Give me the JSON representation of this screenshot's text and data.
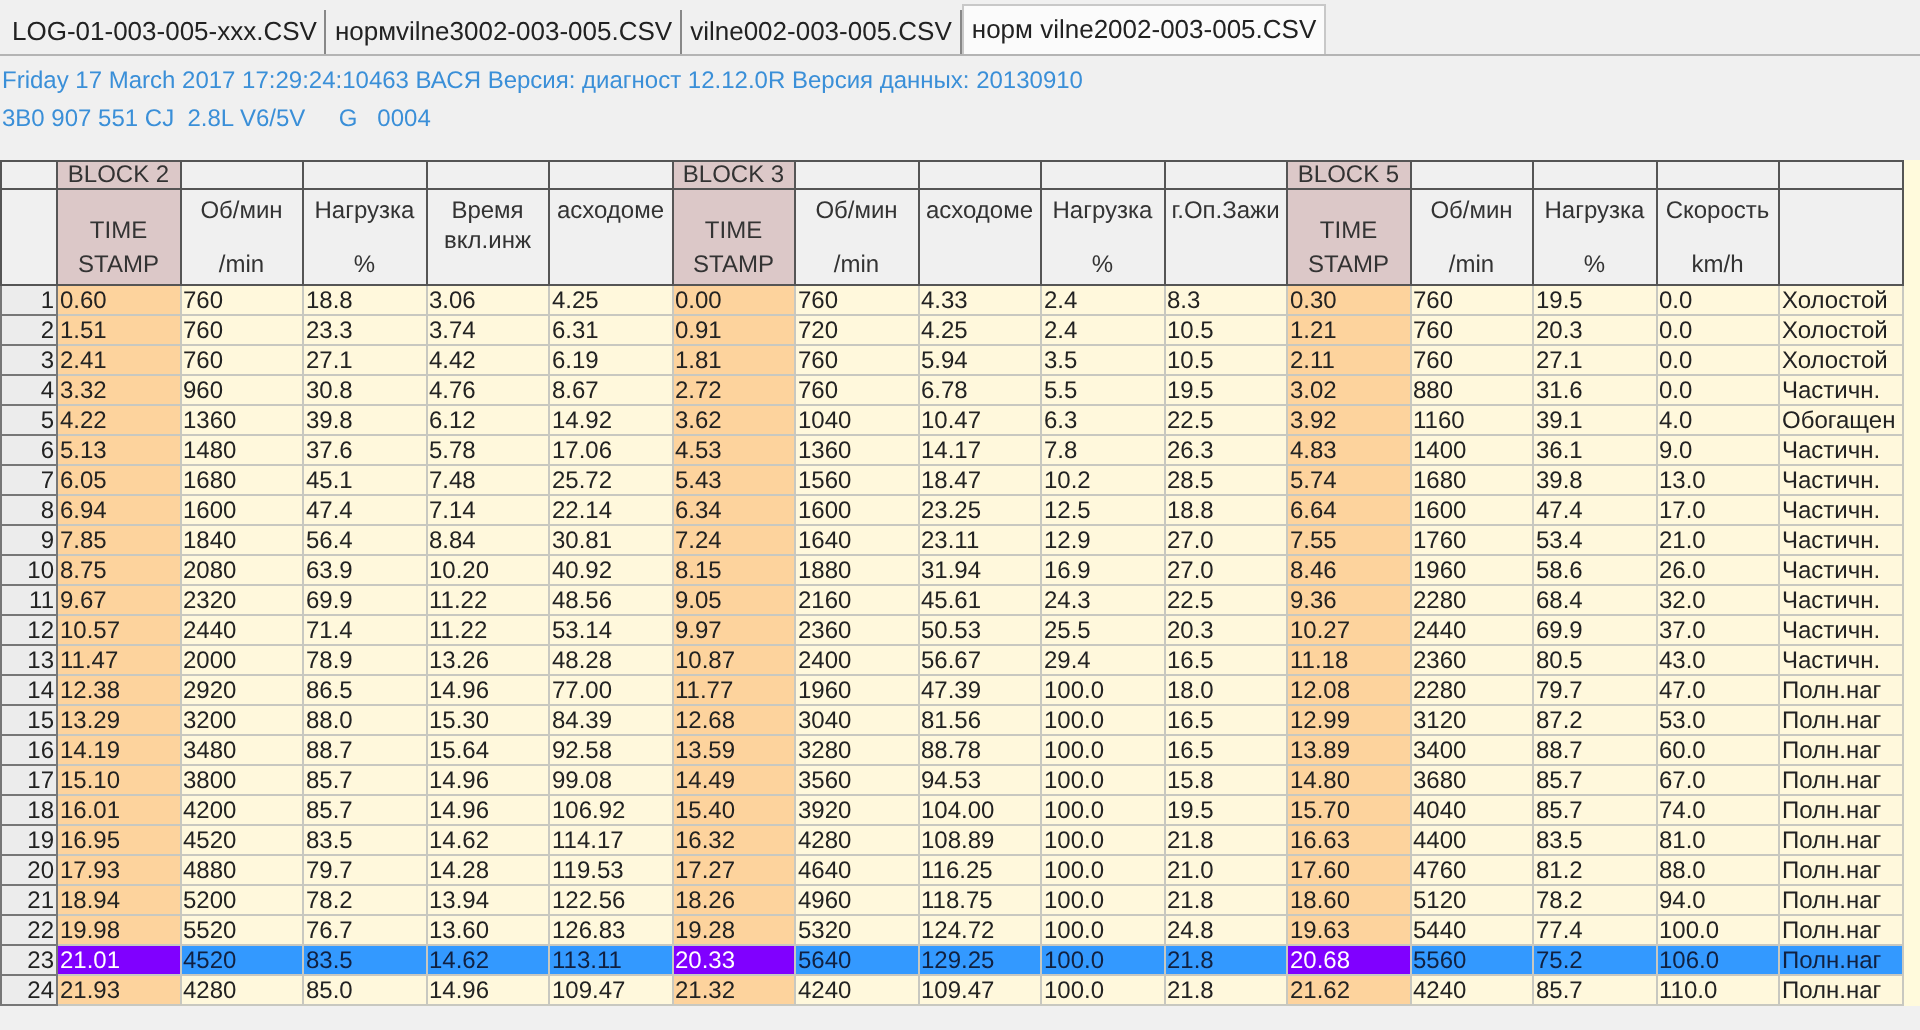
{
  "tabs": [
    {
      "label": "LOG-01-003-005-xxx.CSV",
      "selected": false
    },
    {
      "label": "нормvilne3002-003-005.CSV",
      "selected": false
    },
    {
      "label": "vilne002-003-005.CSV",
      "selected": false
    },
    {
      "label": "норм vilne2002-003-005.CSV",
      "selected": true
    }
  ],
  "info_lines": [
    "Friday 17 March 2017 17:29:24:10463 ВАСЯ Версия: диагност 12.12.0R Версия данных: 20130910",
    "3B0 907 551 CJ  2.8L V6/5V     G   0004"
  ],
  "table": {
    "columns": [
      {
        "kind": "timestamp",
        "block": "BLOCK 2",
        "label": "TIME STAMP"
      },
      {
        "kind": "value",
        "label": "Об/мин",
        "unit": "/min"
      },
      {
        "kind": "value",
        "label": "Нагрузка",
        "unit": "%"
      },
      {
        "kind": "value",
        "label": "Время вкл.инж"
      },
      {
        "kind": "value",
        "label": "асходоме"
      },
      {
        "kind": "timestamp",
        "block": "BLOCK 3",
        "label": "TIME STAMP"
      },
      {
        "kind": "value",
        "label": "Об/мин",
        "unit": "/min"
      },
      {
        "kind": "value",
        "label": "асходоме"
      },
      {
        "kind": "value",
        "label": "Нагрузка",
        "unit": "%"
      },
      {
        "kind": "value",
        "label": "г.Оп.Зажи"
      },
      {
        "kind": "timestamp",
        "block": "BLOCK 5",
        "label": "TIME STAMP"
      },
      {
        "kind": "value",
        "label": "Об/мин",
        "unit": "/min"
      },
      {
        "kind": "value",
        "label": "Нагрузка",
        "unit": "%"
      },
      {
        "kind": "value",
        "label": "Скорость",
        "unit": "km/h"
      },
      {
        "kind": "text"
      }
    ],
    "rows": [
      {
        "number": "1",
        "selected": false,
        "cells": [
          "0.60",
          "760",
          "18.8",
          "3.06",
          "4.25",
          "0.00",
          "760",
          "4.33",
          "2.4",
          "8.3",
          "0.30",
          "760",
          "19.5",
          "0.0",
          "Холостой"
        ]
      },
      {
        "number": "2",
        "selected": false,
        "cells": [
          "1.51",
          "760",
          "23.3",
          "3.74",
          "6.31",
          "0.91",
          "720",
          "4.25",
          "2.4",
          "10.5",
          "1.21",
          "760",
          "20.3",
          "0.0",
          "Холостой"
        ]
      },
      {
        "number": "3",
        "selected": false,
        "cells": [
          "2.41",
          "760",
          "27.1",
          "4.42",
          "6.19",
          "1.81",
          "760",
          "5.94",
          "3.5",
          "10.5",
          "2.11",
          "760",
          "27.1",
          "0.0",
          "Холостой"
        ]
      },
      {
        "number": "4",
        "selected": false,
        "cells": [
          "3.32",
          "960",
          "30.8",
          "4.76",
          "8.67",
          "2.72",
          "760",
          "6.78",
          "5.5",
          "19.5",
          "3.02",
          "880",
          "31.6",
          "0.0",
          "Частичн."
        ]
      },
      {
        "number": "5",
        "selected": false,
        "cells": [
          "4.22",
          "1360",
          "39.8",
          "6.12",
          "14.92",
          "3.62",
          "1040",
          "10.47",
          "6.3",
          "22.5",
          "3.92",
          "1160",
          "39.1",
          "4.0",
          "Обогащен"
        ]
      },
      {
        "number": "6",
        "selected": false,
        "cells": [
          "5.13",
          "1480",
          "37.6",
          "5.78",
          "17.06",
          "4.53",
          "1360",
          "14.17",
          "7.8",
          "26.3",
          "4.83",
          "1400",
          "36.1",
          "9.0",
          "Частичн."
        ]
      },
      {
        "number": "7",
        "selected": false,
        "cells": [
          "6.05",
          "1680",
          "45.1",
          "7.48",
          "25.72",
          "5.43",
          "1560",
          "18.47",
          "10.2",
          "28.5",
          "5.74",
          "1680",
          "39.8",
          "13.0",
          "Частичн."
        ]
      },
      {
        "number": "8",
        "selected": false,
        "cells": [
          "6.94",
          "1600",
          "47.4",
          "7.14",
          "22.14",
          "6.34",
          "1600",
          "23.25",
          "12.5",
          "18.8",
          "6.64",
          "1600",
          "47.4",
          "17.0",
          "Частичн."
        ]
      },
      {
        "number": "9",
        "selected": false,
        "cells": [
          "7.85",
          "1840",
          "56.4",
          "8.84",
          "30.81",
          "7.24",
          "1640",
          "23.11",
          "12.9",
          "27.0",
          "7.55",
          "1760",
          "53.4",
          "21.0",
          "Частичн."
        ]
      },
      {
        "number": "10",
        "selected": false,
        "cells": [
          "8.75",
          "2080",
          "63.9",
          "10.20",
          "40.92",
          "8.15",
          "1880",
          "31.94",
          "16.9",
          "27.0",
          "8.46",
          "1960",
          "58.6",
          "26.0",
          "Частичн."
        ]
      },
      {
        "number": "11",
        "selected": false,
        "cells": [
          "9.67",
          "2320",
          "69.9",
          "11.22",
          "48.56",
          "9.05",
          "2160",
          "45.61",
          "24.3",
          "22.5",
          "9.36",
          "2280",
          "68.4",
          "32.0",
          "Частичн."
        ]
      },
      {
        "number": "12",
        "selected": false,
        "cells": [
          "10.57",
          "2440",
          "71.4",
          "11.22",
          "53.14",
          "9.97",
          "2360",
          "50.53",
          "25.5",
          "20.3",
          "10.27",
          "2440",
          "69.9",
          "37.0",
          "Частичн."
        ]
      },
      {
        "number": "13",
        "selected": false,
        "cells": [
          "11.47",
          "2000",
          "78.9",
          "13.26",
          "48.28",
          "10.87",
          "2400",
          "56.67",
          "29.4",
          "16.5",
          "11.18",
          "2360",
          "80.5",
          "43.0",
          "Частичн."
        ]
      },
      {
        "number": "14",
        "selected": false,
        "cells": [
          "12.38",
          "2920",
          "86.5",
          "14.96",
          "77.00",
          "11.77",
          "1960",
          "47.39",
          "100.0",
          "18.0",
          "12.08",
          "2280",
          "79.7",
          "47.0",
          "Полн.наг"
        ]
      },
      {
        "number": "15",
        "selected": false,
        "cells": [
          "13.29",
          "3200",
          "88.0",
          "15.30",
          "84.39",
          "12.68",
          "3040",
          "81.56",
          "100.0",
          "16.5",
          "12.99",
          "3120",
          "87.2",
          "53.0",
          "Полн.наг"
        ]
      },
      {
        "number": "16",
        "selected": false,
        "cells": [
          "14.19",
          "3480",
          "88.7",
          "15.64",
          "92.58",
          "13.59",
          "3280",
          "88.78",
          "100.0",
          "16.5",
          "13.89",
          "3400",
          "88.7",
          "60.0",
          "Полн.наг"
        ]
      },
      {
        "number": "17",
        "selected": false,
        "cells": [
          "15.10",
          "3800",
          "85.7",
          "14.96",
          "99.08",
          "14.49",
          "3560",
          "94.53",
          "100.0",
          "15.8",
          "14.80",
          "3680",
          "85.7",
          "67.0",
          "Полн.наг"
        ]
      },
      {
        "number": "18",
        "selected": false,
        "cells": [
          "16.01",
          "4200",
          "85.7",
          "14.96",
          "106.92",
          "15.40",
          "3920",
          "104.00",
          "100.0",
          "19.5",
          "15.70",
          "4040",
          "85.7",
          "74.0",
          "Полн.наг"
        ]
      },
      {
        "number": "19",
        "selected": false,
        "cells": [
          "16.95",
          "4520",
          "83.5",
          "14.62",
          "114.17",
          "16.32",
          "4280",
          "108.89",
          "100.0",
          "21.8",
          "16.63",
          "4400",
          "83.5",
          "81.0",
          "Полн.наг"
        ]
      },
      {
        "number": "20",
        "selected": false,
        "cells": [
          "17.93",
          "4880",
          "79.7",
          "14.28",
          "119.53",
          "17.27",
          "4640",
          "116.25",
          "100.0",
          "21.0",
          "17.60",
          "4760",
          "81.2",
          "88.0",
          "Полн.наг"
        ]
      },
      {
        "number": "21",
        "selected": false,
        "cells": [
          "18.94",
          "5200",
          "78.2",
          "13.94",
          "122.56",
          "18.26",
          "4960",
          "118.75",
          "100.0",
          "21.8",
          "18.60",
          "5120",
          "78.2",
          "94.0",
          "Полн.наг"
        ]
      },
      {
        "number": "22",
        "selected": false,
        "cells": [
          "19.98",
          "5520",
          "76.7",
          "13.60",
          "126.83",
          "19.28",
          "5320",
          "124.72",
          "100.0",
          "24.8",
          "19.63",
          "5440",
          "77.4",
          "100.0",
          "Полн.наг"
        ]
      },
      {
        "number": "23",
        "selected": true,
        "cells": [
          "21.01",
          "4520",
          "83.5",
          "14.62",
          "113.11",
          "20.33",
          "5640",
          "129.25",
          "100.0",
          "21.8",
          "20.68",
          "5560",
          "75.2",
          "106.0",
          "Полн.наг"
        ]
      },
      {
        "number": "24",
        "selected": false,
        "cells": [
          "21.93",
          "4280",
          "85.0",
          "14.96",
          "109.47",
          "21.32",
          "4240",
          "109.47",
          "100.0",
          "21.8",
          "21.62",
          "4240",
          "85.7",
          "110.0",
          "Полн.наг"
        ]
      }
    ]
  }
}
